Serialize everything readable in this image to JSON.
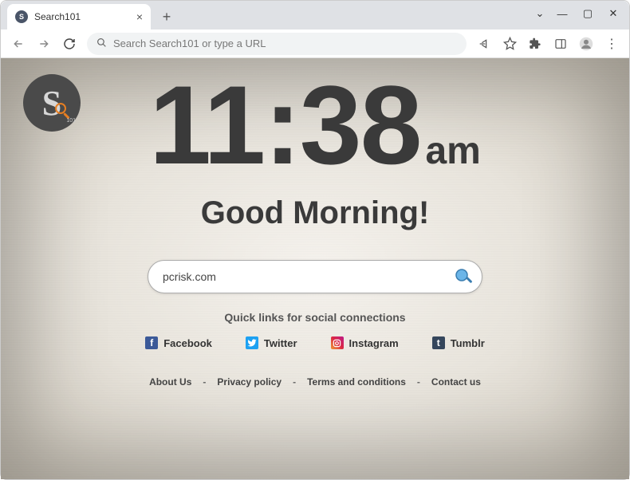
{
  "browser": {
    "tab_title": "Search101",
    "omnibox_placeholder": "Search Search101 or type a URL"
  },
  "logo": {
    "letter": "S",
    "sub": "101"
  },
  "clock": {
    "time": "11:38",
    "ampm": "am"
  },
  "greeting": "Good Morning!",
  "search": {
    "value": "pcrisk.com"
  },
  "quicklinks_label": "Quick links for social connections",
  "social": [
    {
      "label": "Facebook",
      "glyph": "f"
    },
    {
      "label": "Twitter",
      "glyph": "t"
    },
    {
      "label": "Instagram",
      "glyph": "◘"
    },
    {
      "label": "Tumblr",
      "glyph": "t"
    }
  ],
  "footer": [
    "About Us",
    "Privacy policy",
    "Terms and conditions",
    "Contact us"
  ]
}
